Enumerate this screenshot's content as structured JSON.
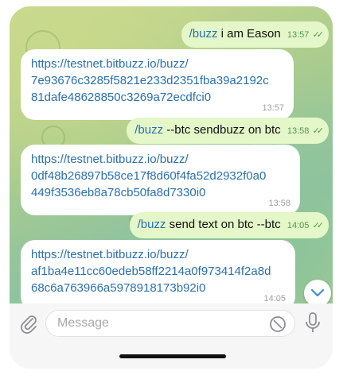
{
  "messages": [
    {
      "type": "out",
      "command": "/buzz",
      "text": " i am Eason",
      "time": "13:57"
    },
    {
      "type": "in",
      "line1": "https://testnet.bitbuzz.io/buzz/",
      "line2": "7e93676c3285f5821e233d2351fba39a2192c",
      "line3": "81dafe48628850c3269a72ecdfci0",
      "time": "13:57"
    },
    {
      "type": "out",
      "command": "/buzz",
      "text": " --btc sendbuzz on btc",
      "time": "13:58"
    },
    {
      "type": "in",
      "line1": "https://testnet.bitbuzz.io/buzz/",
      "line2": "0df48b26897b58ce17f8d60f4fa52d2932f0a0",
      "line3": "449f3536eb8a78cb50fa8d7330i0",
      "time": "13:58"
    },
    {
      "type": "out",
      "command": "/buzz",
      "text": " send text on btc --btc",
      "time": "14:05"
    },
    {
      "type": "in",
      "line1": "https://testnet.bitbuzz.io/buzz/",
      "line2": "af1ba4e11cc60edeb58ff2214a0f973414f2a8d",
      "line3": "68c6a763966a5978918173b92i0",
      "time": "14:05"
    }
  ],
  "ticks": "✓✓",
  "input": {
    "placeholder": "Message"
  },
  "icons": {
    "attach": "paperclip-icon",
    "sticker": "sticker-icon",
    "mic": "microphone-icon",
    "scroll": "chevron-down-icon"
  },
  "colors": {
    "accent": "#2a6fb0",
    "outgoing_bubble": "#e4f7c8",
    "read_ticks": "#4f9b4b"
  }
}
